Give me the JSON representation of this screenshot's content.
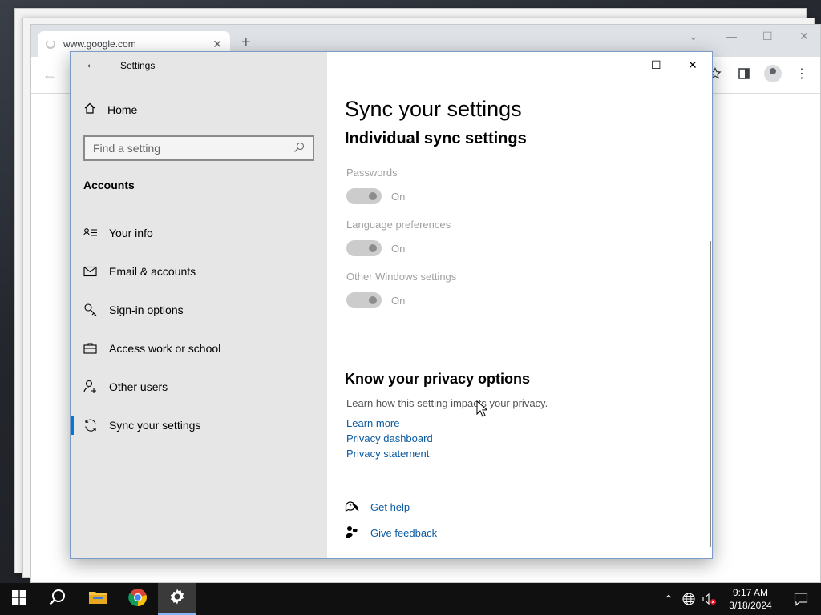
{
  "browser": {
    "tab_title": "www.google.com",
    "tab_close": "✕",
    "new_tab": "+"
  },
  "settings": {
    "window_title": "Settings",
    "nav": {
      "home_label": "Home",
      "search_placeholder": "Find a setting",
      "section_label": "Accounts",
      "items": [
        {
          "label": "Your info",
          "icon": "your-info-icon"
        },
        {
          "label": "Email & accounts",
          "icon": "mail-icon"
        },
        {
          "label": "Sign-in options",
          "icon": "key-icon"
        },
        {
          "label": "Access work or school",
          "icon": "briefcase-icon"
        },
        {
          "label": "Other users",
          "icon": "add-person-icon"
        },
        {
          "label": "Sync your settings",
          "icon": "sync-icon",
          "selected": true
        }
      ]
    },
    "content": {
      "page_title": "Sync your settings",
      "subtitle": "Individual sync settings",
      "sync_items": [
        {
          "label": "Passwords",
          "state": "On",
          "enabled": false
        },
        {
          "label": "Language preferences",
          "state": "On",
          "enabled": false
        },
        {
          "label": "Other Windows settings",
          "state": "On",
          "enabled": false
        }
      ],
      "privacy": {
        "title": "Know your privacy options",
        "description": "Learn how this setting impacts your privacy.",
        "links": [
          "Learn more",
          "Privacy dashboard",
          "Privacy statement"
        ]
      },
      "help": {
        "get_help": "Get help",
        "give_feedback": "Give feedback"
      }
    }
  },
  "taskbar": {
    "time": "9:17 AM",
    "date": "3/18/2024"
  },
  "colors": {
    "accent": "#0078d4",
    "link": "#0b5aa2",
    "nav_bg": "#e6e6e6",
    "disabled_text": "#a0a0a0"
  }
}
